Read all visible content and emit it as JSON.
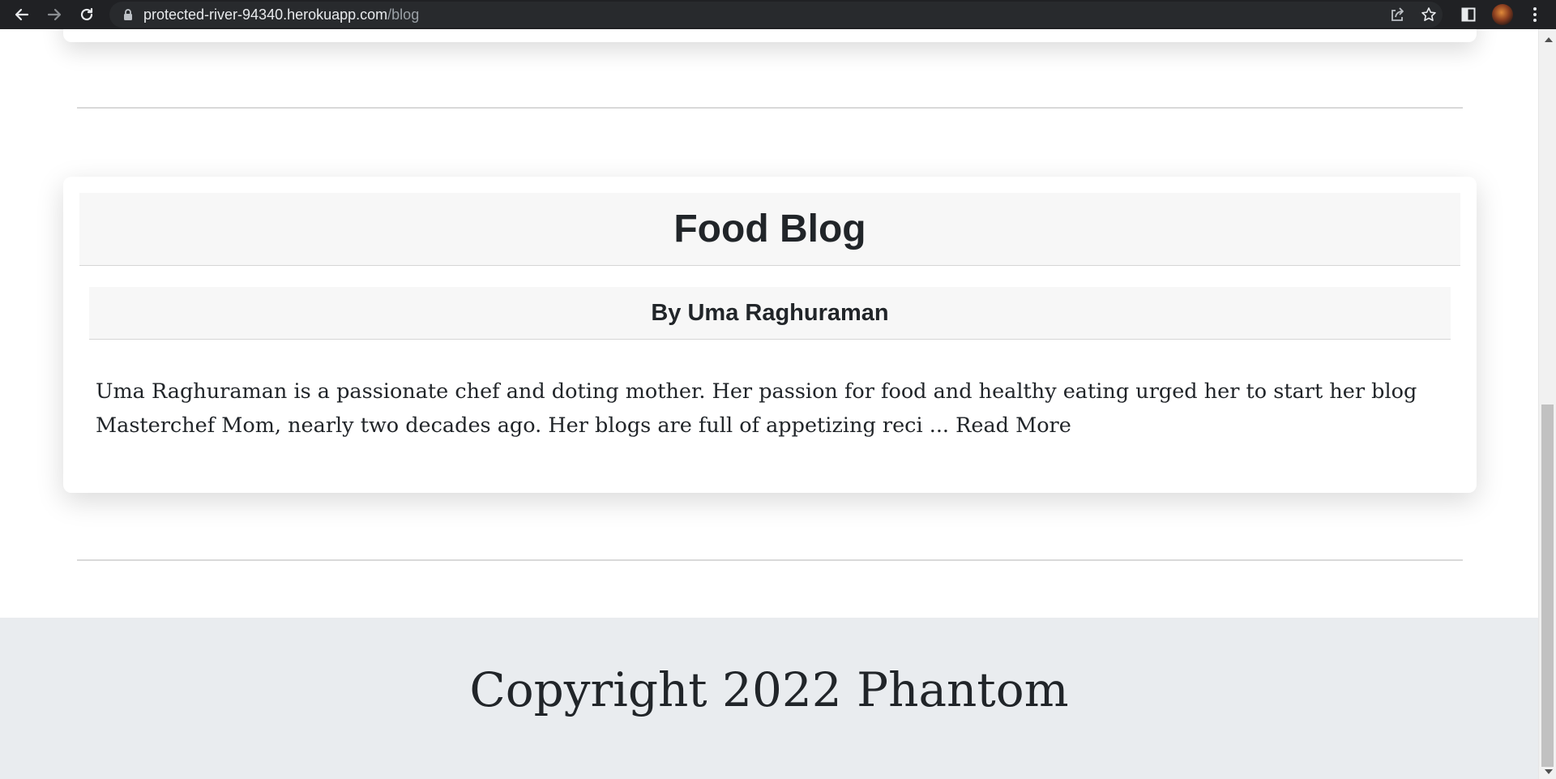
{
  "browser": {
    "url_host": "protected-river-94340.herokuapp.com",
    "url_path": "/blog",
    "icons": [
      "back-arrow-icon",
      "forward-arrow-icon",
      "reload-icon",
      "lock-icon",
      "share-icon",
      "star-icon",
      "side-panel-icon",
      "profile-avatar",
      "kebab-menu-icon"
    ]
  },
  "post": {
    "title": "Food Blog",
    "author": "By Uma Raghuraman",
    "excerpt": "Uma Raghuraman is a passionate chef and doting mother. Her passion for food and healthy eating urged her to start her blog Masterchef Mom, nearly two decades ago. Her blogs are full of appetizing reci ...",
    "read_more": "Read More"
  },
  "footer": {
    "copyright": "Copyright 2022 Phantom"
  },
  "colors": {
    "chrome_bg": "#202124",
    "footer_bg": "#e9ecef",
    "card_header_bg": "#f7f7f7",
    "text": "#212529"
  }
}
